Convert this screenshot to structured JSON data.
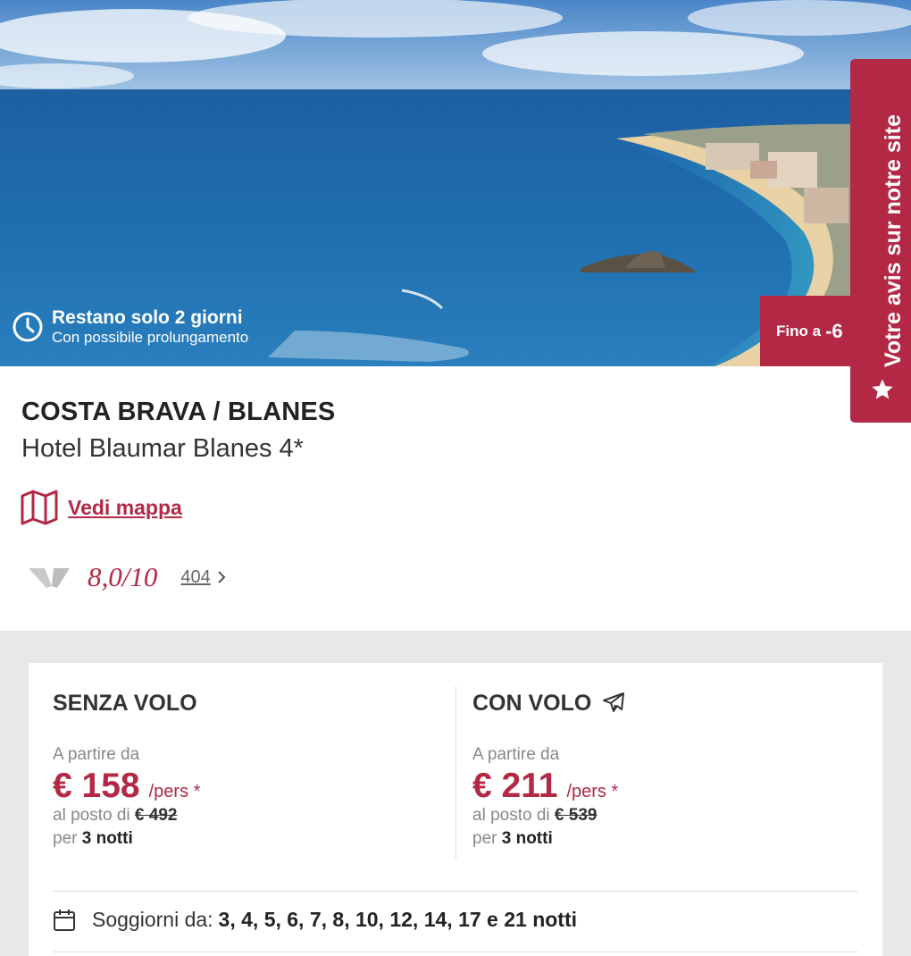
{
  "hero": {
    "timer_title": "Restano solo 2 giorni",
    "timer_subtitle": "Con possibile prolungamento",
    "discount_label": "Fino a",
    "discount_value": "-6"
  },
  "feedback": {
    "label": "Votre avis sur notre site"
  },
  "hotel": {
    "destination": "COSTA BRAVA / BLANES",
    "name": "Hotel Blaumar Blanes 4*",
    "map_link": "Vedi mappa",
    "rating": "8,0/10",
    "reviews_count": "404"
  },
  "offers": {
    "without_flight": {
      "title": "SENZA VOLO",
      "from_label": "A partire da",
      "price": "€ 158",
      "per_person": "/pers *",
      "instead_label": "al posto di",
      "old_price": "€ 492",
      "per_label": "per",
      "nights": "3 notti"
    },
    "with_flight": {
      "title": "CON VOLO",
      "from_label": "A partire da",
      "price": "€ 211",
      "per_person": "/pers *",
      "instead_label": "al posto di",
      "old_price": "€ 539",
      "per_label": "per",
      "nights": "3 notti"
    },
    "stays_label": "Soggiorni da:",
    "stays_values": "3, 4, 5, 6, 7, 8, 10, 12, 14, 17 e 21 notti"
  },
  "colors": {
    "accent": "#b32845",
    "panel_bg": "#e8e8e8"
  },
  "icons": [
    "clock-icon",
    "star-icon",
    "map-icon",
    "rating-logo-icon",
    "chevron-right-icon",
    "plane-icon",
    "calendar-icon"
  ]
}
